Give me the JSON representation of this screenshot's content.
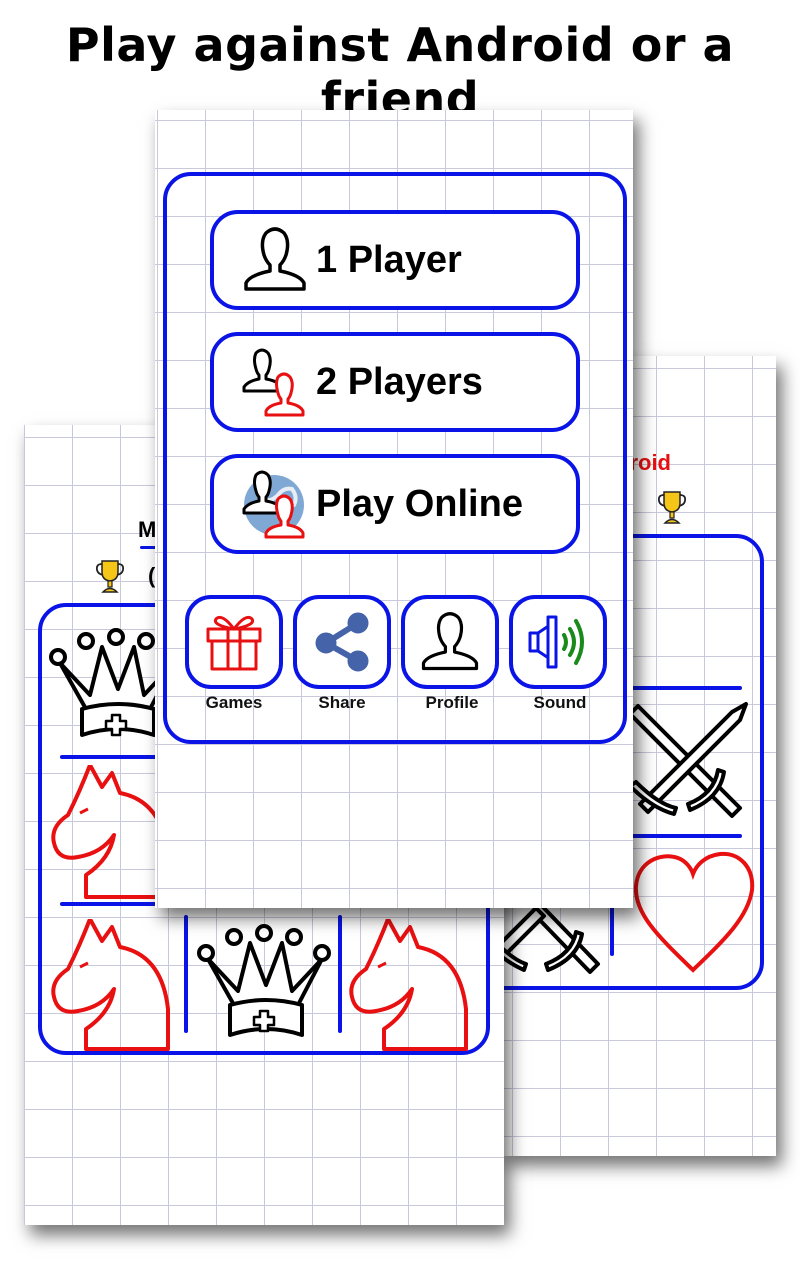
{
  "headline": "Play against Android or a friend",
  "colors": {
    "accent_blue": "#0a14e6",
    "piece_red": "#e81010",
    "trophy_gold": "#f5c518",
    "sound_green": "#1a8a1a",
    "share_blue": "#4563a8"
  },
  "main_menu": {
    "buttons": [
      {
        "label": "1 Player",
        "icon": "single-user-icon"
      },
      {
        "label": "2 Players",
        "icon": "two-users-icon"
      },
      {
        "label": "Play Online",
        "icon": "globe-users-icon"
      }
    ],
    "toolbar": [
      {
        "label": "Games",
        "icon": "gift-icon"
      },
      {
        "label": "Share",
        "icon": "share-icon"
      },
      {
        "label": "Profile",
        "icon": "profile-icon"
      },
      {
        "label": "Sound",
        "icon": "speaker-icon"
      }
    ]
  },
  "left_screen": {
    "player_name_partial": "M",
    "score_partial": "(",
    "trophy_icon": "trophy-icon",
    "pieces": [
      "queen",
      "knight-red",
      "knight-red",
      "queen",
      "knight-red"
    ]
  },
  "right_screen": {
    "player_name_partial": "droid",
    "trophy_icon": "trophy-icon",
    "cells": [
      "crossed-swords",
      "heart-red",
      "crossed-swords"
    ]
  }
}
